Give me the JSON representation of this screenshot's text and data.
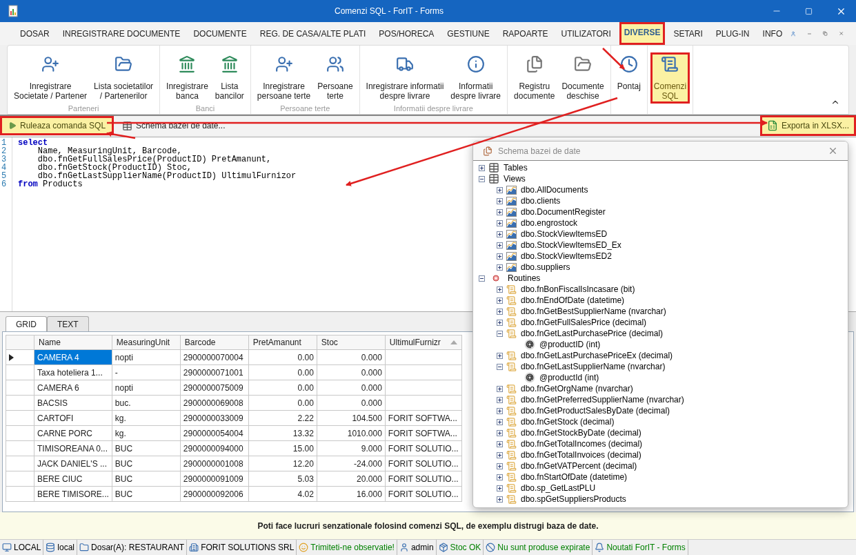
{
  "window": {
    "title": "Comenzi SQL - ForIT - Forms"
  },
  "menu_tabs": [
    {
      "label": "DOSAR",
      "selected": false,
      "annotated": false
    },
    {
      "label": "INREGISTRARE DOCUMENTE",
      "selected": false,
      "annotated": false
    },
    {
      "label": "DOCUMENTE",
      "selected": false,
      "annotated": false
    },
    {
      "label": "REG. DE CASA/ALTE PLATI",
      "selected": false,
      "annotated": false
    },
    {
      "label": "POS/HORECA",
      "selected": false,
      "annotated": false
    },
    {
      "label": "GESTIUNE",
      "selected": false,
      "annotated": false
    },
    {
      "label": "RAPOARTE",
      "selected": false,
      "annotated": false
    },
    {
      "label": "UTILIZATORI",
      "selected": false,
      "annotated": false
    },
    {
      "label": "DIVERSE",
      "selected": true,
      "annotated": true
    },
    {
      "label": "SETARI",
      "selected": false,
      "annotated": false
    },
    {
      "label": "PLUG-IN",
      "selected": false,
      "annotated": false
    },
    {
      "label": "INFO",
      "selected": false,
      "annotated": false
    }
  ],
  "ribbon_groups": [
    {
      "title": "Parteneri",
      "buttons": [
        {
          "label": "Inregistrare\nSocietate / Partener",
          "annotated": false
        },
        {
          "label": "Lista societatilor\n/ Partenerilor",
          "annotated": false
        }
      ]
    },
    {
      "title": "Banci",
      "buttons": [
        {
          "label": "Inregistrare\nbanca",
          "annotated": false
        },
        {
          "label": "Lista\nbancilor",
          "annotated": false
        }
      ]
    },
    {
      "title": "Persoane terte",
      "buttons": [
        {
          "label": "Inregistrare\npersoane terte",
          "annotated": false
        },
        {
          "label": "Persoane\nterte",
          "annotated": false
        }
      ]
    },
    {
      "title": "Informatii despre livrare",
      "buttons": [
        {
          "label": "Inregistrare informatii\ndespre livrare",
          "annotated": false
        },
        {
          "label": "Informatii\ndespre livrare",
          "annotated": false
        }
      ]
    },
    {
      "buttons": [
        {
          "label": "Registru\ndocumente",
          "annotated": false
        },
        {
          "label": "Documente\ndeschise",
          "annotated": false
        }
      ]
    },
    {
      "buttons": [
        {
          "label": "Pontaj",
          "annotated": false
        }
      ]
    },
    {
      "buttons": [
        {
          "label": "Comenzi\nSQL",
          "annotated": true
        }
      ]
    }
  ],
  "toolbar": {
    "buttons": [
      {
        "label": "Ruleaza comanda SQL",
        "annotated": true
      },
      {
        "label": "Schema bazei de date...",
        "annotated": false
      }
    ],
    "export": {
      "label": "Exporta in XLSX...",
      "annotated": true
    }
  },
  "editor": {
    "lines": [
      {
        "number": "1",
        "tokens": [
          {
            "kind": "keyword",
            "text": "select"
          }
        ]
      },
      {
        "number": "2",
        "tokens": [
          {
            "kind": "plain",
            "text": "    Name, MeasuringUnit, Barcode,"
          }
        ]
      },
      {
        "number": "3",
        "tokens": [
          {
            "kind": "plain",
            "text": "    dbo.fnGetFullSalesPrice(ProductID) PretAmanunt,"
          }
        ]
      },
      {
        "number": "4",
        "tokens": [
          {
            "kind": "plain",
            "text": "    dbo.fnGetStock(ProductID) Stoc,"
          }
        ]
      },
      {
        "number": "5",
        "tokens": [
          {
            "kind": "plain",
            "text": "    dbo.fnGetLastSupplierName(ProductID) UltimulFurnizor"
          }
        ]
      },
      {
        "number": "6",
        "tokens": [
          {
            "kind": "keyword",
            "text": "from"
          },
          {
            "kind": "plain",
            "text": " Products"
          }
        ]
      }
    ]
  },
  "result_tabs": [
    {
      "label": "GRID",
      "selected": true
    },
    {
      "label": "TEXT",
      "selected": false
    }
  ],
  "grid": {
    "columns": [
      {
        "label": "Name",
        "kind": "text",
        "sorted": false
      },
      {
        "label": "MeasuringUnit",
        "kind": "text",
        "sorted": false
      },
      {
        "label": "Barcode",
        "kind": "text",
        "sorted": false
      },
      {
        "label": "PretAmanunt",
        "kind": "number",
        "sorted": false
      },
      {
        "label": "Stoc",
        "kind": "number",
        "sorted": false
      },
      {
        "label": "UltimulFurnizr",
        "kind": "text",
        "sorted": true
      }
    ],
    "rows": [
      {
        "selected": true,
        "cells": [
          "CAMERA 4",
          "nopti",
          "2900000070004",
          "0.00",
          "0.000",
          ""
        ]
      },
      {
        "selected": false,
        "cells": [
          "Taxa hoteliera 1...",
          "-",
          "2900000071001",
          "0.00",
          "0.000",
          ""
        ]
      },
      {
        "selected": false,
        "cells": [
          "CAMERA 6",
          "nopti",
          "2900000075009",
          "0.00",
          "0.000",
          ""
        ]
      },
      {
        "selected": false,
        "cells": [
          "BACSIS",
          "buc.",
          "2900000069008",
          "0.00",
          "0.000",
          ""
        ]
      },
      {
        "selected": false,
        "cells": [
          "CARTOFI",
          "kg.",
          "2900000033009",
          "2.22",
          "104.500",
          "FORIT SOFTWA..."
        ]
      },
      {
        "selected": false,
        "cells": [
          "CARNE PORC",
          "kg.",
          "2900000054004",
          "13.32",
          "1010.000",
          "FORIT SOFTWA..."
        ]
      },
      {
        "selected": false,
        "cells": [
          "TIMISOREANA 0...",
          "BUC",
          "2900000094000",
          "15.00",
          "9.000",
          "FORIT SOLUTIO..."
        ]
      },
      {
        "selected": false,
        "cells": [
          "JACK DANIEL'S ...",
          "BUC",
          "2900000001008",
          "12.20",
          "-24.000",
          "FORIT SOLUTIO..."
        ]
      },
      {
        "selected": false,
        "cells": [
          "BERE CIUC",
          "BUC",
          "2900000091009",
          "5.03",
          "20.000",
          "FORIT SOLUTIO..."
        ]
      },
      {
        "selected": false,
        "cells": [
          "BERE TIMISORE...",
          "BUC",
          "2900000092006",
          "4.02",
          "16.000",
          "FORIT SOLUTIO..."
        ]
      }
    ]
  },
  "schema_dialog": {
    "title": "Schema bazei de date",
    "tree": [
      {
        "label": "Tables",
        "kind": "tables",
        "expanded": false
      },
      {
        "label": "Views",
        "kind": "views",
        "expanded": true,
        "children": [
          {
            "label": "dbo.AllDocuments",
            "kind": "view",
            "expanded": false
          },
          {
            "label": "dbo.clients",
            "kind": "view",
            "expanded": false
          },
          {
            "label": "dbo.DocumentRegister",
            "kind": "view",
            "expanded": false
          },
          {
            "label": "dbo.engrostock",
            "kind": "view",
            "expanded": false
          },
          {
            "label": "dbo.StockViewItemsED",
            "kind": "view",
            "expanded": false
          },
          {
            "label": "dbo.StockViewItemsED_Ex",
            "kind": "view",
            "expanded": false
          },
          {
            "label": "dbo.StockViewItemsED2",
            "kind": "view",
            "expanded": false
          },
          {
            "label": "dbo.suppliers",
            "kind": "view",
            "expanded": false
          }
        ]
      },
      {
        "label": "Routines",
        "kind": "routines",
        "expanded": true,
        "children": [
          {
            "label": "dbo.fnBonFiscalIsIncasare (bit)",
            "kind": "routine",
            "expanded": false
          },
          {
            "label": "dbo.fnEndOfDate (datetime)",
            "kind": "routine",
            "expanded": false
          },
          {
            "label": "dbo.fnGetBestSupplierName (nvarchar)",
            "kind": "routine",
            "expanded": false
          },
          {
            "label": "dbo.fnGetFullSalesPrice (decimal)",
            "kind": "routine",
            "expanded": false
          },
          {
            "label": "dbo.fnGetLastPurchasePrice (decimal)",
            "kind": "routine",
            "expanded": true,
            "children": [
              {
                "label": "@productID (int)",
                "kind": "param"
              }
            ]
          },
          {
            "label": "dbo.fnGetLastPurchasePriceEx (decimal)",
            "kind": "routine",
            "expanded": false
          },
          {
            "label": "dbo.fnGetLastSupplierName (nvarchar)",
            "kind": "routine",
            "expanded": true,
            "children": [
              {
                "label": "@productId (int)",
                "kind": "param"
              }
            ]
          },
          {
            "label": "dbo.fnGetOrgName (nvarchar)",
            "kind": "routine",
            "expanded": false
          },
          {
            "label": "dbo.fnGetPreferredSupplierName (nvarchar)",
            "kind": "routine",
            "expanded": false
          },
          {
            "label": "dbo.fnGetProductSalesByDate (decimal)",
            "kind": "routine",
            "expanded": false
          },
          {
            "label": "dbo.fnGetStock (decimal)",
            "kind": "routine",
            "expanded": false
          },
          {
            "label": "dbo.fnGetStockByDate (decimal)",
            "kind": "routine",
            "expanded": false
          },
          {
            "label": "dbo.fnGetTotalIncomes (decimal)",
            "kind": "routine",
            "expanded": false
          },
          {
            "label": "dbo.fnGetTotalInvoices (decimal)",
            "kind": "routine",
            "expanded": false
          },
          {
            "label": "dbo.fnGetVATPercent (decimal)",
            "kind": "routine",
            "expanded": false
          },
          {
            "label": "dbo.fnStartOfDate (datetime)",
            "kind": "routine",
            "expanded": false
          },
          {
            "label": "dbo.sp_GetLastPLU",
            "kind": "routine",
            "expanded": false
          },
          {
            "label": "dbo.spGetSuppliersProducts",
            "kind": "routine",
            "expanded": false
          }
        ]
      }
    ]
  },
  "message": "Poti face lucruri senzationale folosind comenzi SQL, de exemplu distrugi baza de date.",
  "status_bar": [
    {
      "label": "LOCAL",
      "color": "#000000"
    },
    {
      "label": "local",
      "color": "#000000"
    },
    {
      "label": "Dosar(A): RESTAURANT",
      "color": "#000000"
    },
    {
      "label": "FORIT SOLUTIONS SRL",
      "color": "#000000"
    },
    {
      "label": "Trimiteti-ne observatie!",
      "color": "#008000"
    },
    {
      "label": "admin",
      "color": "#000000"
    },
    {
      "label": "Stoc OK",
      "color": "#008000"
    },
    {
      "label": "Nu sunt produse expirate",
      "color": "#008000"
    },
    {
      "label": "Noutati ForIT - Forms",
      "color": "#008000"
    }
  ]
}
